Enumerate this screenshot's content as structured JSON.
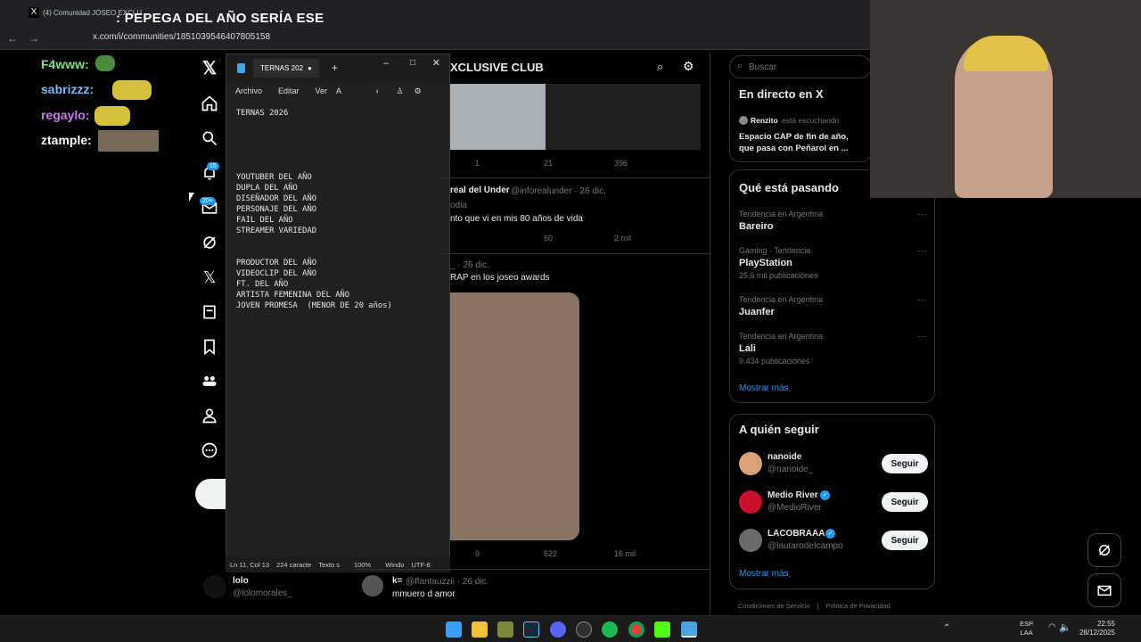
{
  "browser": {
    "tab_title": "(4) Comunidad JOSEO EXCLU",
    "url": "x.com/i/communities/1851039546407805158",
    "overlay_caption": ": PEPEGA DEL AÑO SERÍA ESE"
  },
  "chat": [
    {
      "user": "F4www:",
      "color": "#7ee07e"
    },
    {
      "user": "sabrizzz:",
      "color": "#7ab8ff"
    },
    {
      "user": "regaylo:",
      "color": "#c97be8"
    },
    {
      "user": "ztample:",
      "color": "#ffffff"
    }
  ],
  "nav": {
    "notifications_badge": "15",
    "messages_badge": "20+"
  },
  "notepad": {
    "tab_title": "TERNAS 202",
    "menu": [
      "Archivo",
      "Editar",
      "Ver"
    ],
    "content": "TERNAS 2026\n\n\n\n\n\nYOUTUBER DEL AÑO\nDUPLA DEL AÑO\nDISEÑADOR DEL AÑO\nPERSONAJE DEL AÑO\nFAIL DEL AÑO\nSTREAMER VARIEDAD\n\n\nPRODUCTOR DEL AÑO\nVIDEOCLIP DEL AÑO\nFT. DEL AÑO\nARTISTA FEMENINA DEL AÑO\nJOVEN PROMESA  (MENOR DE 20 años)",
    "status": {
      "position": "Ln 11, Col 13",
      "chars": "224 caracte",
      "mode": "Texto s",
      "zoom": "100%",
      "eol": "Windo",
      "encoding": "UTF-8"
    }
  },
  "feed": {
    "title": "XCLUSIVE CLUB",
    "posts": [
      {
        "reposts": "1",
        "likes": "21",
        "views": "396"
      },
      {
        "author": "real del Under",
        "handle": "@inforealunder · 26 dic.",
        "category": "odia",
        "text": "nto que vi en mis 80 años de vida",
        "likes": "60",
        "views": "2 mil"
      },
      {
        "handle": "_ · 26 dic.",
        "text": "RAP en los joseo awards",
        "reposts": "9",
        "likes": "622",
        "views": "16 mil"
      },
      {
        "author": "k=",
        "handle": "@ffantauzzii · 26 dic.",
        "text": "mmuero d amor"
      }
    ],
    "lolo": {
      "name": "lolo",
      "handle": "@lolomorales_"
    }
  },
  "sidebar": {
    "search_placeholder": "Buscar",
    "live": {
      "title": "En directo en X",
      "listener": "Renzito",
      "listening": "está escuchando",
      "space_title": "Espacio CAP de fin de año, que pasa con Peñarol en ..."
    },
    "trends_title": "Qué está pasando",
    "trends": [
      {
        "context": "Tendencia en Argentina",
        "name": "Bareiro",
        "count": ""
      },
      {
        "context": "Gaming · Tendencia",
        "name": "PlayStation",
        "count": "25,6 mil publicaciones"
      },
      {
        "context": "Tendencia en Argentina",
        "name": "Juanfer",
        "count": ""
      },
      {
        "context": "Tendencia en Argentina",
        "name": "Lali",
        "count": "9.434 publicaciones"
      }
    ],
    "show_more": "Mostrar más",
    "follow_title": "A quién seguir",
    "follow": [
      {
        "name": "nanoide",
        "handle": "@nanoide_",
        "avatar_color": "#d9a07a"
      },
      {
        "name": "Medio River",
        "handle": "@MedioRiver",
        "avatar_color": "#c8102e"
      },
      {
        "name": "LACOBRAAA",
        "handle": "@lautarodeIcampo",
        "avatar_color": "#6a6a6a"
      }
    ],
    "follow_button": "Seguir",
    "show_more_2": "Mostrar más",
    "footer": [
      "Condiciones de Servicio",
      "Política de Privacidad"
    ]
  },
  "taskbar": {
    "lang": "ESP",
    "lang2": "LAA",
    "time": "22:55",
    "date": "28/12/2025"
  }
}
